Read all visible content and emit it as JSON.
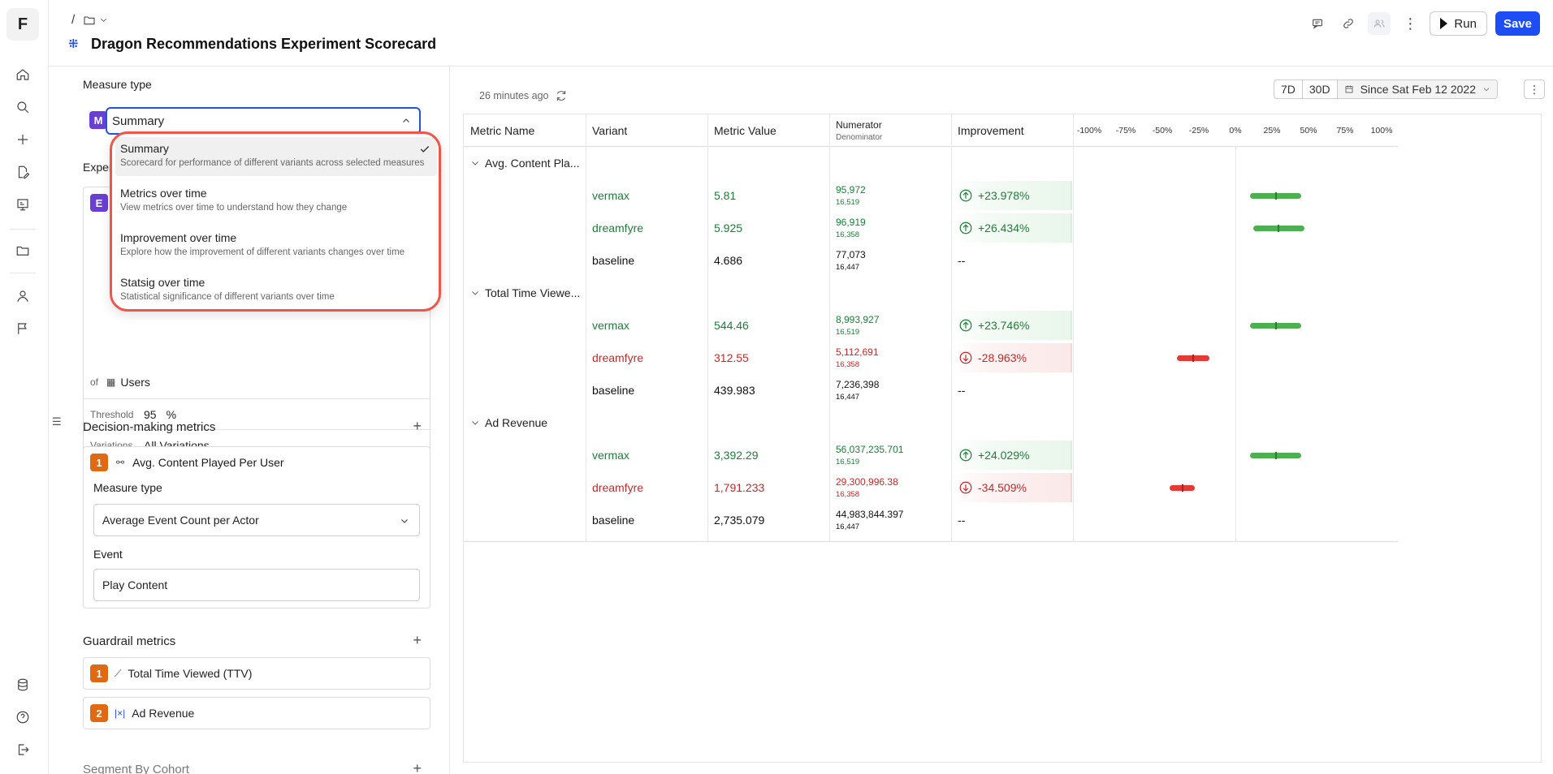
{
  "app": {
    "logo": "F"
  },
  "rail": {
    "icons": [
      "home-icon",
      "search-icon",
      "plus-icon",
      "edit-doc-icon",
      "experiment-icon",
      "folder-icon",
      "user-icon",
      "flag-icon",
      "database-icon",
      "help-icon",
      "logout-icon"
    ]
  },
  "header": {
    "breadcrumb_sep": "/",
    "title": "Dragon Recommendations Experiment Scorecard",
    "run_label": "Run",
    "save_label": "Save"
  },
  "config": {
    "measure_type_label": "Measure type",
    "measure_type_badge": "M",
    "measure_type_value": "Summary",
    "experiment_label_partial": "Exper",
    "experiment_badge": "E",
    "of_label": "of",
    "of_value": "Users",
    "threshold_label": "Threshold",
    "threshold_value": "95",
    "threshold_unit": "%",
    "variations_label": "Variations",
    "variations_value": "All Variations",
    "decision_title": "Decision-making metrics",
    "decision_metric": {
      "index": "1",
      "name": "Avg. Content Played Per User",
      "measure_type_label": "Measure type",
      "measure_type_value": "Average Event Count per Actor",
      "event_label": "Event",
      "event_value": "Play Content"
    },
    "guardrail_title": "Guardrail metrics",
    "guardrails": [
      {
        "index": "1",
        "name": "Total Time Viewed (TTV)"
      },
      {
        "index": "2",
        "name": "Ad Revenue"
      }
    ],
    "segment_title": "Segment By Cohort"
  },
  "dropdown": {
    "options": [
      {
        "label": "Summary",
        "desc": "Scorecard for performance of different variants across selected measures",
        "selected": true
      },
      {
        "label": "Metrics over time",
        "desc": "View metrics over time to understand how they change",
        "selected": false
      },
      {
        "label": "Improvement over time",
        "desc": "Explore how the improvement of different variants changes over time",
        "selected": false
      },
      {
        "label": "Statsig over time",
        "desc": "Statistical significance of different variants over time",
        "selected": false
      }
    ]
  },
  "results": {
    "updated": "26 minutes ago",
    "range": {
      "seven": "7D",
      "thirty": "30D",
      "since": "Since Sat Feb 12 2022"
    },
    "columns": {
      "metric": "Metric Name",
      "variant": "Variant",
      "value": "Metric Value",
      "numerator": "Numerator",
      "denominator": "Denominator",
      "improvement": "Improvement"
    },
    "axis_ticks": [
      "-100%",
      "-75%",
      "-50%",
      "-25%",
      "0%",
      "25%",
      "50%",
      "75%",
      "100%"
    ],
    "groups": [
      {
        "name": "Avg. Content Pla...",
        "rows": [
          {
            "variant": "vermax",
            "value": "5.81",
            "num": "95,972",
            "den": "16,519",
            "imp": "+23.978%",
            "dir": "pos",
            "ci": [
              10,
              45
            ],
            "mid": 27.5
          },
          {
            "variant": "dreamfyre",
            "value": "5.925",
            "num": "96,919",
            "den": "16,358",
            "imp": "+26.434%",
            "dir": "pos",
            "ci": [
              12,
              47
            ],
            "mid": 29.5
          },
          {
            "variant": "baseline",
            "value": "4.686",
            "num": "77,073",
            "den": "16,447",
            "imp": "--",
            "dir": "base"
          }
        ]
      },
      {
        "name": "Total Time Viewe...",
        "rows": [
          {
            "variant": "vermax",
            "value": "544.46",
            "num": "8,993,927",
            "den": "16,519",
            "imp": "+23.746%",
            "dir": "pos",
            "ci": [
              10,
              45
            ],
            "mid": 27.5
          },
          {
            "variant": "dreamfyre",
            "value": "312.55",
            "num": "5,112,691",
            "den": "16,358",
            "imp": "-28.963%",
            "dir": "neg",
            "ci": [
              -40,
              -18
            ],
            "mid": -29
          },
          {
            "variant": "baseline",
            "value": "439.983",
            "num": "7,236,398",
            "den": "16,447",
            "imp": "--",
            "dir": "base"
          }
        ]
      },
      {
        "name": "Ad Revenue",
        "rows": [
          {
            "variant": "vermax",
            "value": "3,392.29",
            "num": "56,037,235.701",
            "den": "16,519",
            "imp": "+24.029%",
            "dir": "pos",
            "ci": [
              10,
              45
            ],
            "mid": 27.5
          },
          {
            "variant": "dreamfyre",
            "value": "1,791.233",
            "num": "29,300,996.38",
            "den": "16,358",
            "imp": "-34.509%",
            "dir": "neg",
            "ci": [
              -45,
              -28
            ],
            "mid": -36
          },
          {
            "variant": "baseline",
            "value": "2,735.079",
            "num": "44,983,844.397",
            "den": "16,447",
            "imp": "--",
            "dir": "base"
          }
        ]
      }
    ]
  }
}
